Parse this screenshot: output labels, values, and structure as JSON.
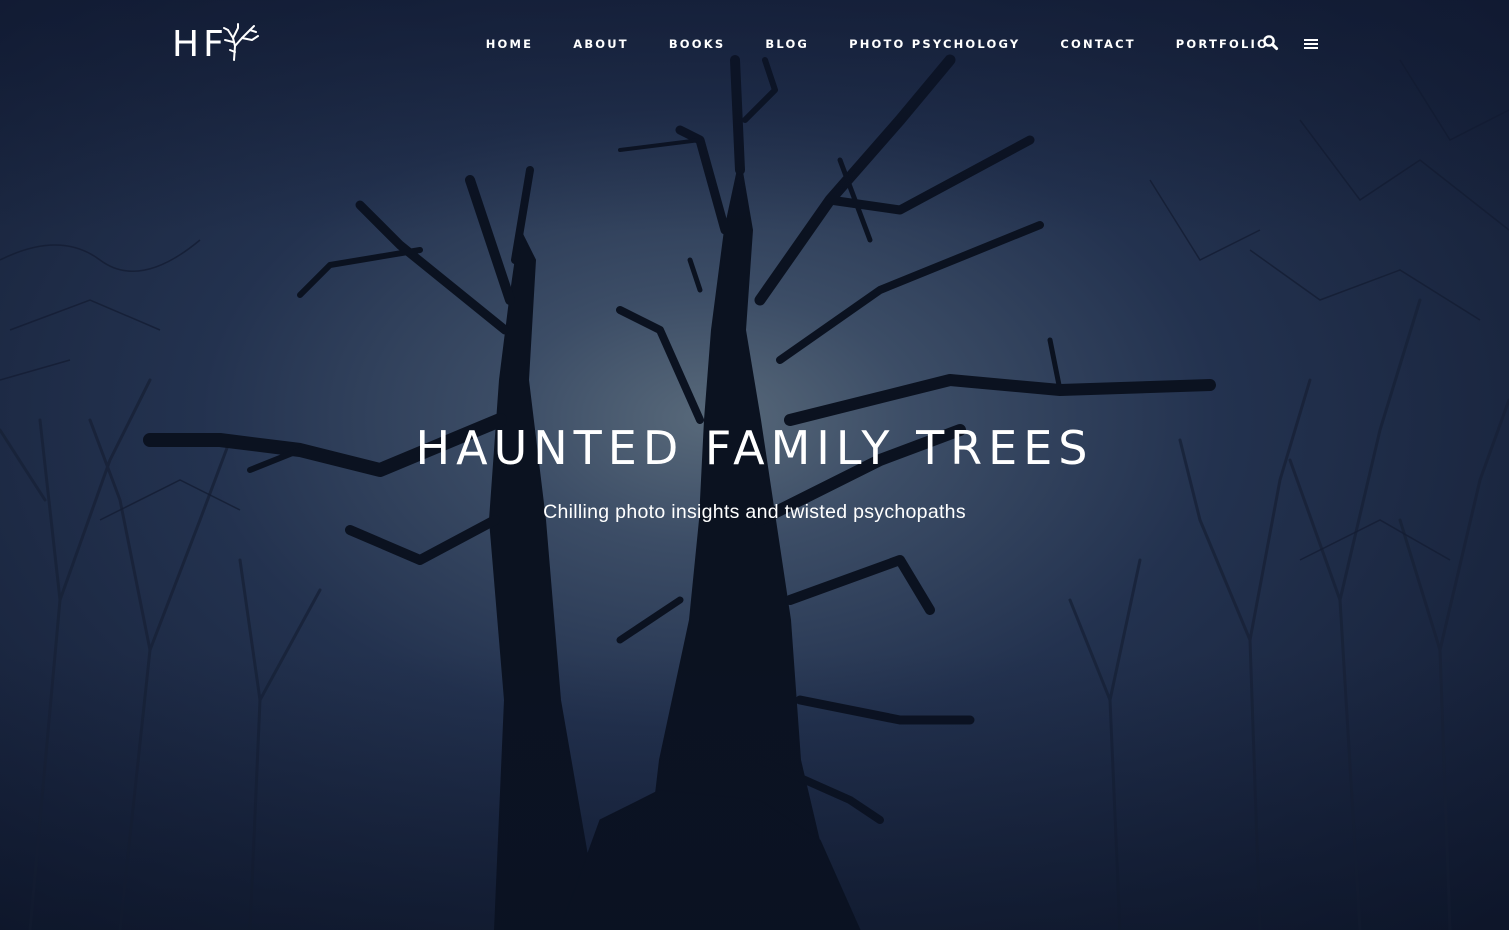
{
  "site": {
    "logo_text": "HF",
    "logo_icon": "dead-tree-icon"
  },
  "nav": {
    "items": [
      {
        "label": "HOME"
      },
      {
        "label": "ABOUT"
      },
      {
        "label": "BOOKS"
      },
      {
        "label": "BLOG"
      },
      {
        "label": "PHOTO PSYCHOLOGY"
      },
      {
        "label": "CONTACT"
      },
      {
        "label": "PORTFOLIO"
      }
    ],
    "search_icon": "search-icon",
    "menu_icon": "hamburger-menu-icon"
  },
  "hero": {
    "title": "HAUNTED FAMILY TREES",
    "subtitle": "Chilling photo insights and twisted psychopaths",
    "background": "night-forest-dead-tree-photo"
  },
  "colors": {
    "text": "#ffffff",
    "sky_center": "#4a5a6e",
    "sky_mid": "#253452",
    "sky_edge": "#0f1a2e",
    "silhouette": "#0b1220"
  }
}
